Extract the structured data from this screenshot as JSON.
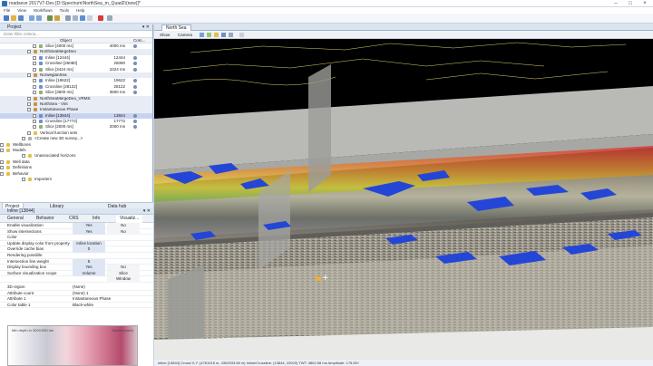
{
  "window": {
    "title": "roadseve 2017V7-Dev [D:\\Spectrum\\NorthSea_m_Quad2\\(new)]*"
  },
  "menu": [
    "File",
    "View",
    "Workflows",
    "Tools",
    "Help"
  ],
  "project_panel": {
    "title": "Project",
    "filter_placeholder": "Enter filter criteria...",
    "columns": {
      "object": "Object",
      "comment": "Com..."
    },
    "rows": [
      {
        "label": "Slice [4000 ms]",
        "value": "4000 ms",
        "indent": 50,
        "type": "slice"
      },
      {
        "label": "NorthSeaMergeDeo",
        "value": "",
        "indent": 44,
        "type": "survey",
        "header": true
      },
      {
        "label": "Inline [12444]",
        "value": "12444",
        "indent": 50,
        "type": "inline"
      },
      {
        "label": "Crossline [26080]",
        "value": "26080",
        "indent": 50,
        "type": "inline"
      },
      {
        "label": "Slice [3424 ms]",
        "value": "3424 ms",
        "indent": 50,
        "type": "slice"
      },
      {
        "label": "NorwegianSea",
        "value": "",
        "indent": 44,
        "type": "survey",
        "header": true
      },
      {
        "label": "Inline [19622]",
        "value": "19622",
        "indent": 50,
        "type": "inline"
      },
      {
        "label": "Crossline [28122]",
        "value": "28122",
        "indent": 50,
        "type": "inline"
      },
      {
        "label": "Slice [3500 ms]",
        "value": "3500 ms",
        "indent": 50,
        "type": "slice"
      },
      {
        "label": "NorthSeaMergeDeo_VRMS",
        "value": "",
        "indent": 44,
        "type": "survey",
        "header": true
      },
      {
        "label": "NorthSea - Vint",
        "value": "",
        "indent": 44,
        "type": "survey",
        "header": true
      },
      {
        "label": "Instantaneous Phase",
        "value": "",
        "indent": 44,
        "type": "survey",
        "header": true
      },
      {
        "label": "Inline [13844]",
        "value": "13844",
        "indent": 50,
        "type": "inline",
        "selected": true
      },
      {
        "label": "Crossline [17772]",
        "value": "17772",
        "indent": 50,
        "type": "inline"
      },
      {
        "label": "Slice [2000 ms]",
        "value": "2000 ms",
        "indent": 50,
        "type": "slice"
      },
      {
        "label": "Vertical function sets",
        "value": "",
        "indent": 44,
        "type": "folder"
      },
      {
        "label": "<Create new 3D survey...>",
        "value": "",
        "indent": 38,
        "type": "new"
      },
      {
        "label": "Wellbores",
        "value": "",
        "indent": 14,
        "type": "folder"
      },
      {
        "label": "Models",
        "value": "",
        "indent": 14,
        "type": "folder"
      },
      {
        "label": "Unassociated horizons",
        "value": "",
        "indent": 38,
        "type": "folder"
      },
      {
        "label": "Well data",
        "value": "",
        "indent": 14,
        "type": "folder"
      },
      {
        "label": "Definitions",
        "value": "",
        "indent": 14,
        "type": "folder"
      },
      {
        "label": "Behavior",
        "value": "",
        "indent": 14,
        "type": "folder"
      },
      {
        "label": "Importers",
        "value": "",
        "indent": 38,
        "type": "folder"
      }
    ],
    "tabs": [
      "Project",
      "Library",
      "Data hub"
    ]
  },
  "properties_panel": {
    "title": "Inline [13844]",
    "tabs": [
      "General",
      "Behavior",
      "CRS",
      "Info",
      "Visualiz..."
    ],
    "rows": [
      {
        "key": "Enable visualization",
        "v1": "Yes",
        "v2": "No"
      },
      {
        "key": "Show intersections",
        "v1": "Yes",
        "v2": "No"
      },
      {
        "key": "Color",
        "v1": "",
        "v2": ""
      },
      {
        "key": "Update display color from property",
        "v1": "Inline location",
        "v2": ""
      },
      {
        "key": "Override cache bias",
        "v1": "0",
        "v2": ""
      },
      {
        "key": "Rendering possible",
        "v1": "",
        "v2": ""
      },
      {
        "key": "Intersection line weight",
        "v1": "5",
        "v2": ""
      },
      {
        "key": "Display bounding box",
        "v1": "Yes",
        "v2": "No"
      },
      {
        "key": "Surface visualization scope",
        "v1": "Volume",
        "v2": "Slice"
      },
      {
        "key": "",
        "v1": "",
        "v2": "Window"
      }
    ],
    "section_rows": [
      {
        "key": "3D region",
        "v1": "(None)"
      },
      {
        "key": "Attribute count",
        "v1": "(None)   1"
      },
      {
        "key": "Attribute 1",
        "v1": "Instantaneous Phase"
      },
      {
        "key": "Color table 1",
        "v1": "Black-white"
      }
    ],
    "colorbar": {
      "left_label": "Min depth in 3000:000 ms",
      "right_label": "Depth (more)"
    }
  },
  "viewport": {
    "tab": "North Sea",
    "toolbar": [
      "Show",
      "Camera"
    ],
    "status": "Inline [13844]   Crossl X,Y: (4761015 m, 4302533.58 m)   Inline/Crossline: (13844, 22020) TWT: 3862.58 ms   Amplitude: 175.65+"
  }
}
